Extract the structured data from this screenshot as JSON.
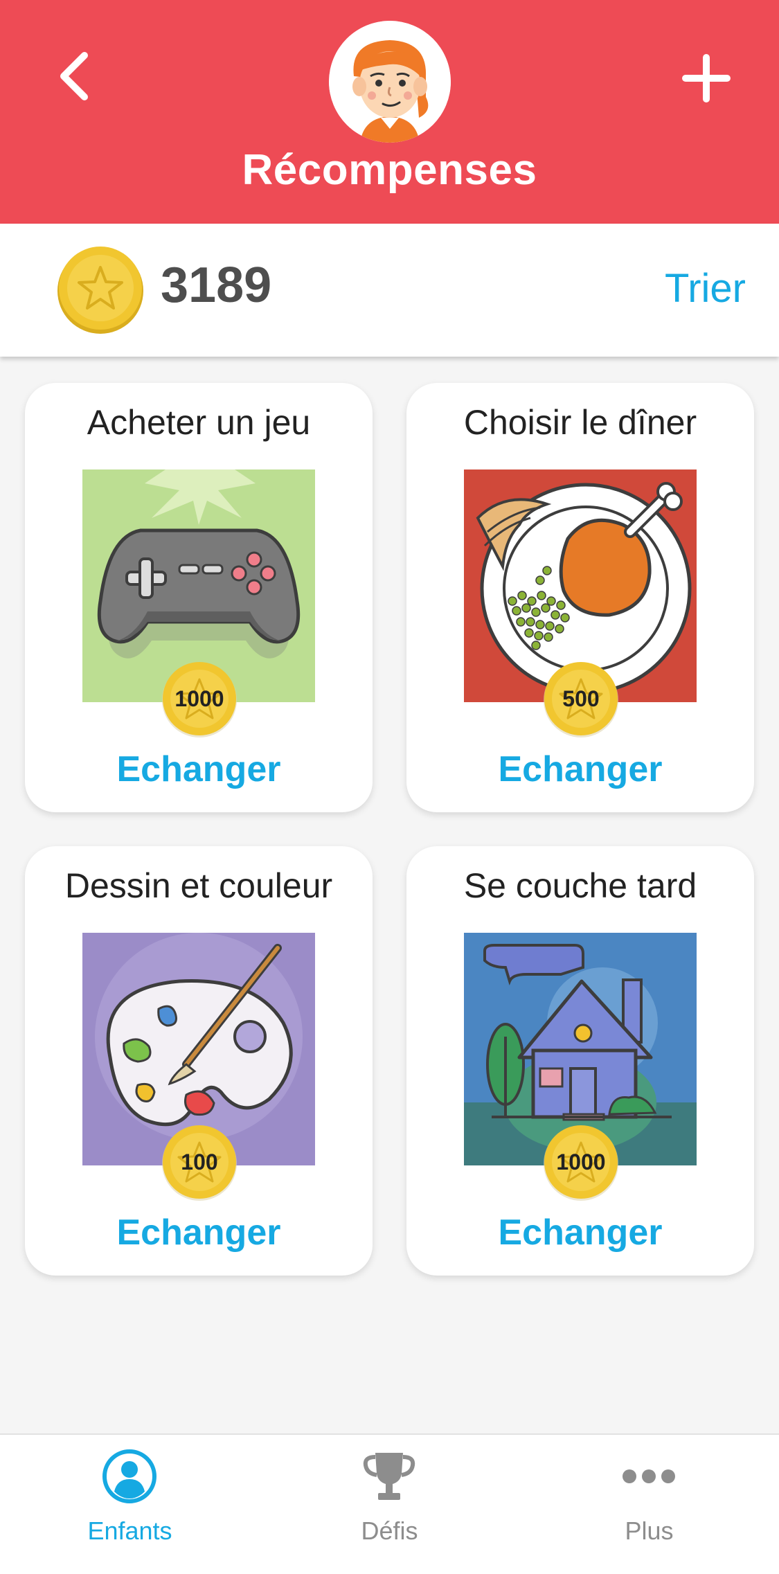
{
  "header": {
    "title": "Récompenses",
    "back_icon": "chevron-left-icon",
    "add_icon": "plus-icon",
    "avatar": "child-avatar",
    "color": "#ee4b55"
  },
  "balance": {
    "coin_icon": "star-coin-icon",
    "value": "3189",
    "sort_label": "Trier"
  },
  "rewards": [
    {
      "title": "Acheter un jeu",
      "image": "gamepad-image",
      "price": "1000",
      "action": "Echanger"
    },
    {
      "title": "Choisir le dîner",
      "image": "dinner-plate-image",
      "price": "500",
      "action": "Echanger"
    },
    {
      "title": "Dessin et couleur",
      "image": "paint-palette-image",
      "price": "100",
      "action": "Echanger"
    },
    {
      "title": "Se couche tard",
      "image": "night-house-image",
      "price": "1000",
      "action": "Echanger"
    }
  ],
  "nav": {
    "items": [
      {
        "label": "Enfants",
        "icon": "user-circle-icon",
        "active": true
      },
      {
        "label": "Défis",
        "icon": "trophy-icon",
        "active": false
      },
      {
        "label": "Plus",
        "icon": "more-dots-icon",
        "active": false
      }
    ]
  },
  "colors": {
    "accent": "#16a9e2",
    "header": "#ee4b55",
    "coin": "#f1c62f",
    "inactive": "#8d8d8d"
  }
}
